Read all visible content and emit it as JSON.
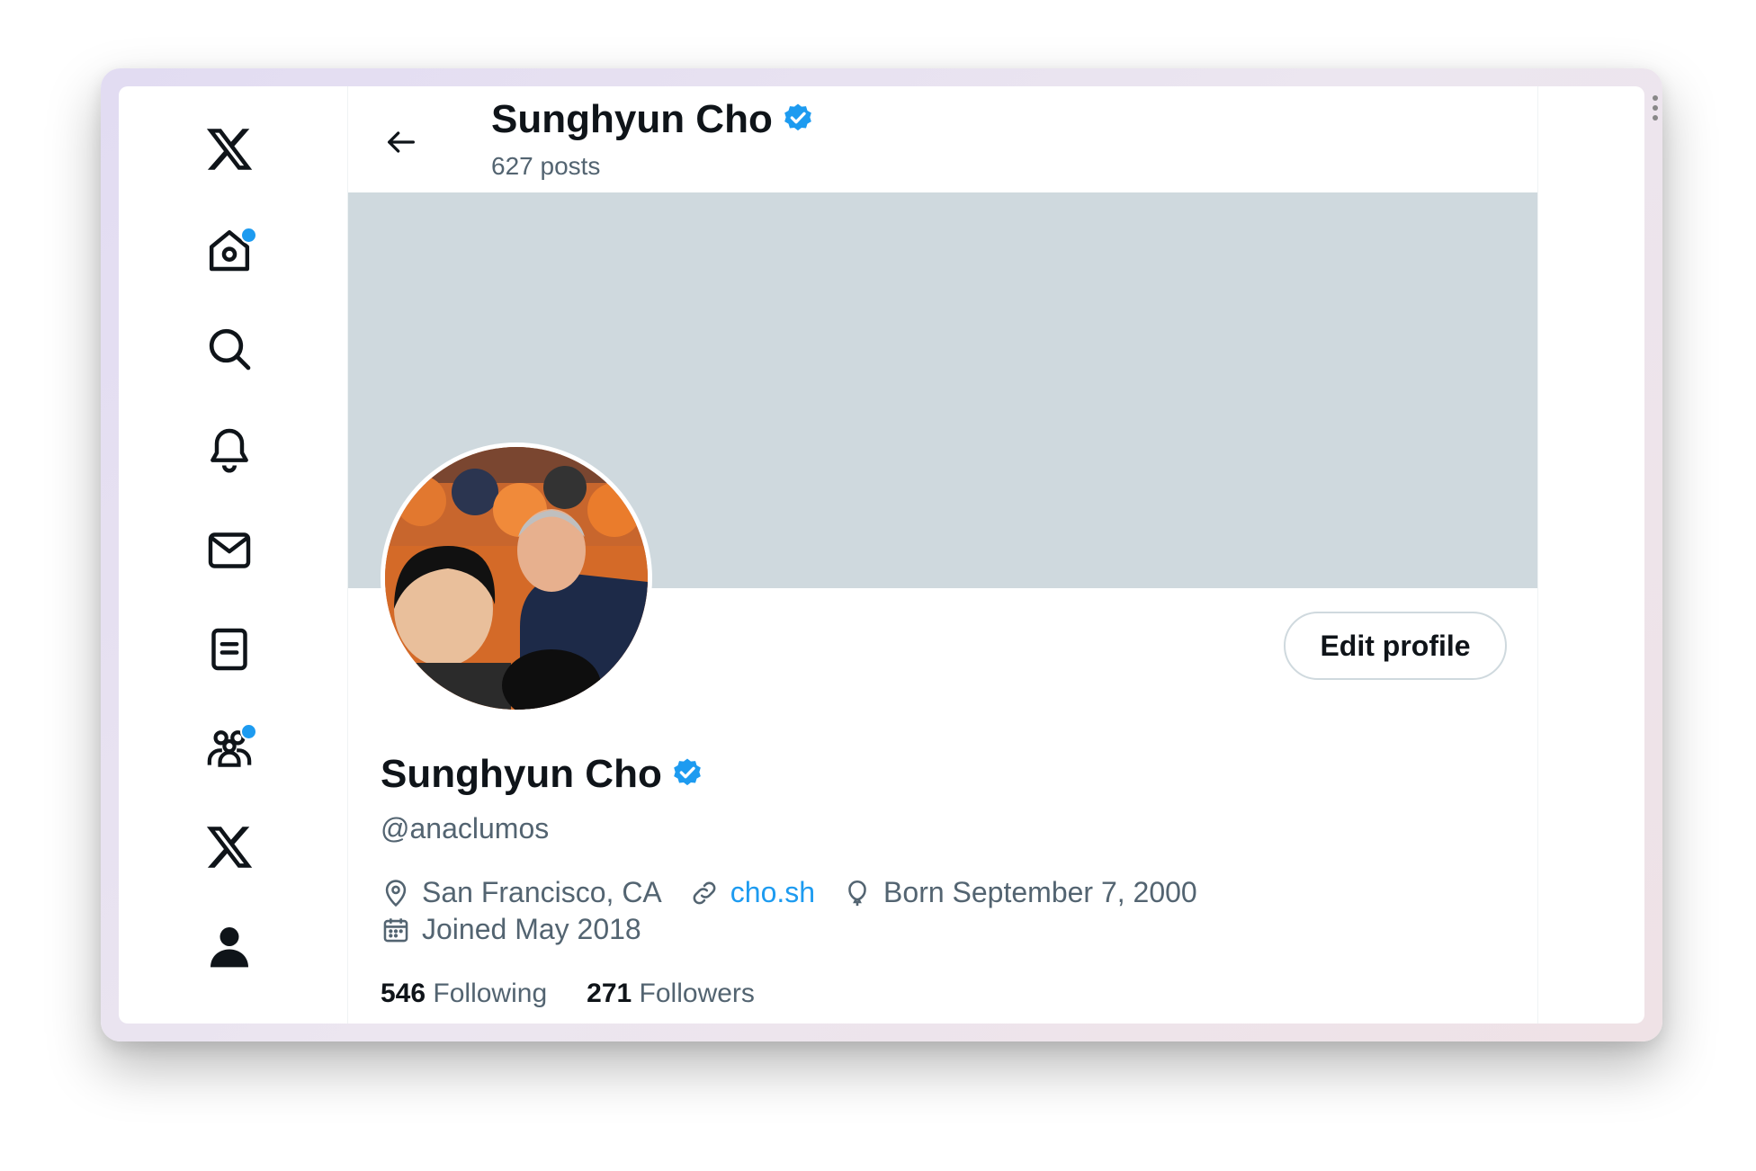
{
  "header": {
    "display_name": "Sunghyun Cho",
    "posts_count": "627 posts"
  },
  "profile": {
    "display_name": "Sunghyun Cho",
    "handle": "@anaclumos",
    "location": "San Francisco, CA",
    "website": "cho.sh",
    "birthday": "Born September 7, 2000",
    "joined": "Joined May 2018",
    "following_count": "546",
    "following_label": "Following",
    "followers_count": "271",
    "followers_label": "Followers",
    "edit_label": "Edit profile",
    "verified": true
  },
  "nav": {
    "items": [
      {
        "icon": "x-logo-icon"
      },
      {
        "icon": "home-icon",
        "badge": true
      },
      {
        "icon": "search-icon"
      },
      {
        "icon": "bell-icon"
      },
      {
        "icon": "mail-icon"
      },
      {
        "icon": "lists-icon"
      },
      {
        "icon": "communities-icon",
        "badge": true
      },
      {
        "icon": "x-premium-icon"
      },
      {
        "icon": "profile-icon"
      }
    ]
  },
  "colors": {
    "accent": "#1d9bf0",
    "banner": "#cfd9de",
    "text_primary": "#0f1419",
    "text_secondary": "#536471"
  }
}
